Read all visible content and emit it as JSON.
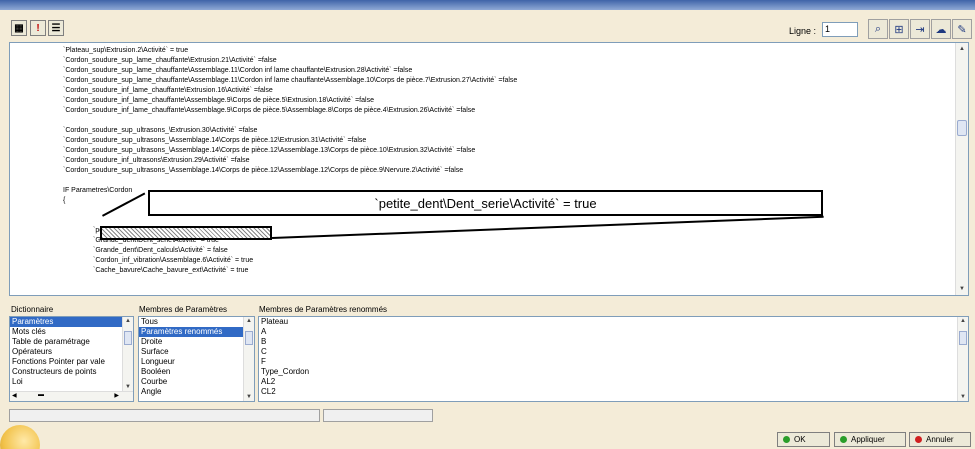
{
  "toolbar": {
    "icons": [
      "view-icon",
      "exclamation-icon",
      "list-icon"
    ],
    "ligne_label": "Ligne :",
    "ligne_value": "1",
    "right_icons": [
      "binoculars-icon",
      "tree-icon",
      "goto-icon",
      "speech-icon",
      "eraser-icon"
    ]
  },
  "editor": {
    "lines": [
      "`Plateau_sup\\Extrusion.2\\Activité` = true",
      "`Cordon_soudure_sup_lame_chauffante\\Extrusion.21\\Activité` =false",
      "`Cordon_soudure_sup_lame_chauffante\\Assemblage.11\\Cordon inf lame chauffante\\Extrusion.28\\Activité` =false",
      "`Cordon_soudure_sup_lame_chauffante\\Assemblage.11\\Cordon inf lame chauffante\\Assemblage.10\\Corps de pièce.7\\Extrusion.27\\Activité` =false",
      "`Cordon_soudure_inf_lame_chauffante\\Extrusion.16\\Activité` =false",
      "`Cordon_soudure_inf_lame_chauffante\\Assemblage.9\\Corps de pièce.5\\Extrusion.18\\Activité` =false",
      "`Cordon_soudure_inf_lame_chauffante\\Assemblage.9\\Corps de pièce.5\\Assemblage.8\\Corps de pièce.4\\Extrusion.26\\Activité` =false",
      "",
      "`Cordon_soudure_sup_ultrasons_\\Extrusion.30\\Activité` =false",
      "`Cordon_soudure_sup_ultrasons_\\Assemblage.14\\Corps de pièce.12\\Extrusion.31\\Activité` =false",
      "`Cordon_soudure_sup_ultrasons_\\Assemblage.14\\Corps de pièce.12\\Assemblage.13\\Corps de pièce.10\\Extrusion.32\\Activité` =false",
      "`Cordon_soudure_inf_ultrasons\\Extrusion.29\\Activité` =false",
      "`Cordon_soudure_sup_ultrasons_\\Assemblage.14\\Corps de pièce.12\\Assemblage.12\\Corps de pièce.9\\Nervure.2\\Activité` =false",
      "",
      "IF Parametres\\Cordon",
      "{"
    ],
    "indented_lines": [
      "`petite_dent\\Dent_calculs\\Activité` = false",
      "`Grande_dent\\Dent_serie\\Activité` = true",
      "`Grande_dent\\Dent_calculs\\Activité` = false",
      "`Cordon_inf_vibration\\Assemblage.6\\Activité` = true",
      "`Cache_bavure\\Cache_bavure_ext\\Activité` = true"
    ],
    "zoom_text": "`petite_dent\\Dent_serie\\Activité` = true"
  },
  "panels": {
    "dictionnaire": {
      "header": "Dictionnaire",
      "items": [
        "Paramètres",
        "Mots clés",
        "Table de paramétrage",
        "Opérateurs",
        "Fonctions Pointer par vale",
        "Constructeurs de points",
        "Loi"
      ],
      "selected": 0
    },
    "membres": {
      "header": "Membres de Paramètres",
      "items": [
        "Tous",
        "Paramètres renommés",
        "Droite",
        "Surface",
        "Longueur",
        "Booléen",
        "Courbe",
        "Angle"
      ],
      "selected": 1
    },
    "renommes": {
      "header": "Membres de Paramètres renommés",
      "items": [
        "Plateau",
        "A",
        "B",
        "C",
        "F",
        "Type_Cordon",
        "AL2",
        "CL2"
      ]
    }
  },
  "buttons": {
    "ok": "OK",
    "apply": "Appliquer",
    "cancel": "Annuler"
  },
  "colors": {
    "ok": "#2a9d2a",
    "apply": "#2a9d2a",
    "cancel": "#d02020",
    "selection": "#316ac5"
  }
}
